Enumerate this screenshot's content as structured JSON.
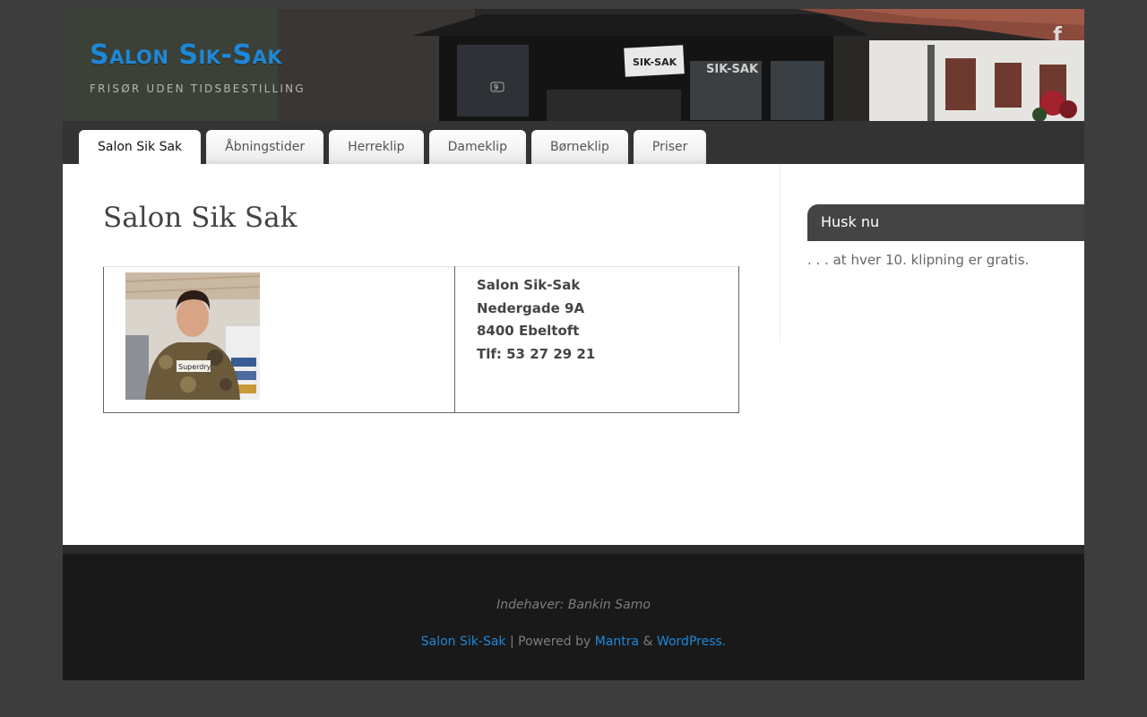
{
  "header": {
    "site_title": "Salon Sik-Sak",
    "tagline": "Frisør uden tidsbestilling",
    "social_icon": "facebook-icon",
    "banner_sign": "SIK-SAK",
    "house_number": "9"
  },
  "nav": {
    "items": [
      {
        "label": "Salon Sik Sak",
        "active": true
      },
      {
        "label": "Åbningstider"
      },
      {
        "label": "Herreklip"
      },
      {
        "label": "Dameklip"
      },
      {
        "label": "Børneklip"
      },
      {
        "label": "Priser"
      }
    ]
  },
  "content": {
    "title": "Salon Sik Sak",
    "photo_shirt_text": "Superdry.",
    "address": {
      "name": "Salon Sik-Sak",
      "street": "Nedergade 9A",
      "city": "8400 Ebeltoft",
      "phone": "Tlf: 53 27 29 21"
    }
  },
  "sidebar": {
    "widget_title": "Husk nu",
    "widget_text": ". . . at hver 10. klipning er gratis."
  },
  "footer": {
    "owner": "Indehaver: Bankin Samo",
    "site_link": "Salon Sik-Sak",
    "separator": "|",
    "powered_by": "Powered by",
    "theme_link": "Mantra",
    "ampersand": "&",
    "wp_link": "WordPress."
  },
  "colors": {
    "accent": "#1e87d8",
    "page_bg": "#3d3d3d",
    "nav_bg": "#333333",
    "footer_bg": "#191919"
  }
}
